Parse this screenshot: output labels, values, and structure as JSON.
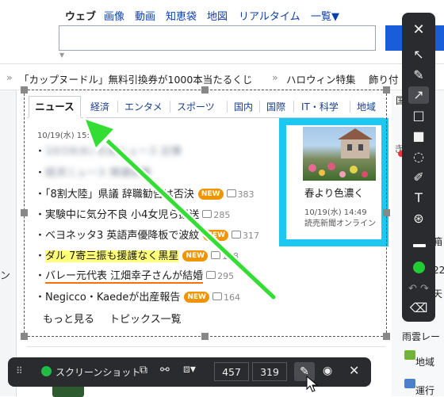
{
  "search_tabs": [
    {
      "label": "ウェブ",
      "active": true
    },
    {
      "label": "画像",
      "active": false
    },
    {
      "label": "動画",
      "active": false
    },
    {
      "label": "知恵袋",
      "active": false
    },
    {
      "label": "地図",
      "active": false
    },
    {
      "label": "リアルタイム",
      "active": false
    },
    {
      "label": "一覧▼",
      "active": false
    }
  ],
  "search": {
    "value": "",
    "placeholder": ""
  },
  "ticker": {
    "item1": "「カップヌードル」無料引換券が1000本当たるくじ",
    "item2": "ハロウィン特集",
    "item3": "飾り付"
  },
  "left_partial": "ン",
  "news_tabs": [
    "ニュース",
    "経済",
    "エンタメ",
    "スポーツ",
    "国内",
    "国際",
    "IT・科学",
    "地域"
  ],
  "timestamp": "10/19(水) 15:",
  "news": [
    {
      "title": "10/19(水) 社会ニュース 記事",
      "blurred": true,
      "new": false,
      "comments": ""
    },
    {
      "title": "経済ニュース 関連記事",
      "blurred": true,
      "new": false,
      "comments": ""
    },
    {
      "title": "「8割大陸」県議 辞職勧告は否決",
      "blurred": false,
      "new": true,
      "comments": "383"
    },
    {
      "title": "実験中に気分不良 小4女児ら搬送",
      "blurred": false,
      "new": false,
      "comments": "285"
    },
    {
      "title": "ベヨネッタ3 英語声優降板で波紋",
      "blurred": false,
      "new": true,
      "comments": "317"
    },
    {
      "title": "ダル 7寄三振も援護なく黒星",
      "blurred": false,
      "new": true,
      "comments": "188"
    },
    {
      "title": "バレー元代表 江畑幸子さんが結婚",
      "blurred": false,
      "new": false,
      "comments": "295"
    },
    {
      "title": "Negicco・Kaedeが出産報告",
      "blurred": false,
      "new": true,
      "comments": "164"
    }
  ],
  "more_link": "もっと見る",
  "topics_link": "トピックス一覧",
  "new_badge": "NEW",
  "featured": {
    "title": "春より色濃く",
    "time": "10/19(水) 14:49",
    "source": "読売新聞オンライン"
  },
  "right_col": {
    "a": "国",
    "b": "型",
    "c": "き",
    "d": "箱",
    "e": "22",
    "f": "天",
    "g": "行",
    "h": "雨雲レー",
    "i": "地域",
    "j": "運行"
  },
  "lower": {
    "snippet": "」"
  },
  "bottom_toolbar": {
    "screenshot_label": "スクリーンショット",
    "width_value": "457",
    "height_value": "319"
  },
  "colors": {
    "arrow": "#33dd33",
    "highlight": "#ffff7a",
    "underline": "#ff7000",
    "cyan_frame": "#1dc8f0",
    "toolbar": "#2a2b2e",
    "search_button": "#1a5dd8"
  }
}
